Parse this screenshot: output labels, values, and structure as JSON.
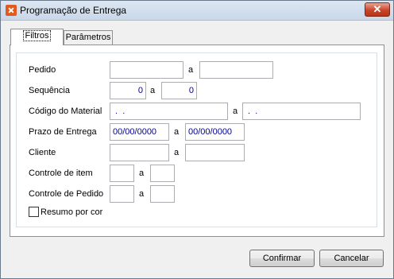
{
  "window": {
    "title": "Programação de Entrega",
    "close_glyph": "✕"
  },
  "tabs": [
    {
      "label": "Filtros",
      "active": true
    },
    {
      "label": "Parâmetros",
      "active": false
    }
  ],
  "form": {
    "pedido": {
      "label": "Pedido",
      "sep": "a",
      "from": "",
      "to": ""
    },
    "sequencia": {
      "label": "Sequência",
      "sep": "a",
      "from": "0",
      "to": "0"
    },
    "codigo_material": {
      "label": "Código do Material",
      "sep": "a",
      "from": " .  .",
      "to": " .  ."
    },
    "prazo_entrega": {
      "label": "Prazo de Entrega",
      "sep": "a",
      "from": "00/00/0000",
      "to": "00/00/0000"
    },
    "cliente": {
      "label": "Cliente",
      "sep": "a",
      "from": "",
      "to": ""
    },
    "controle_item": {
      "label": "Controle de item",
      "sep": "a",
      "from": "",
      "to": ""
    },
    "controle_pedido": {
      "label": "Controle de Pedido",
      "sep": "a",
      "from": "",
      "to": ""
    },
    "resumo_por_cor": {
      "label": "Resumo por cor",
      "checked": false
    }
  },
  "buttons": {
    "confirmar": "Confirmar",
    "cancelar": "Cancelar"
  }
}
